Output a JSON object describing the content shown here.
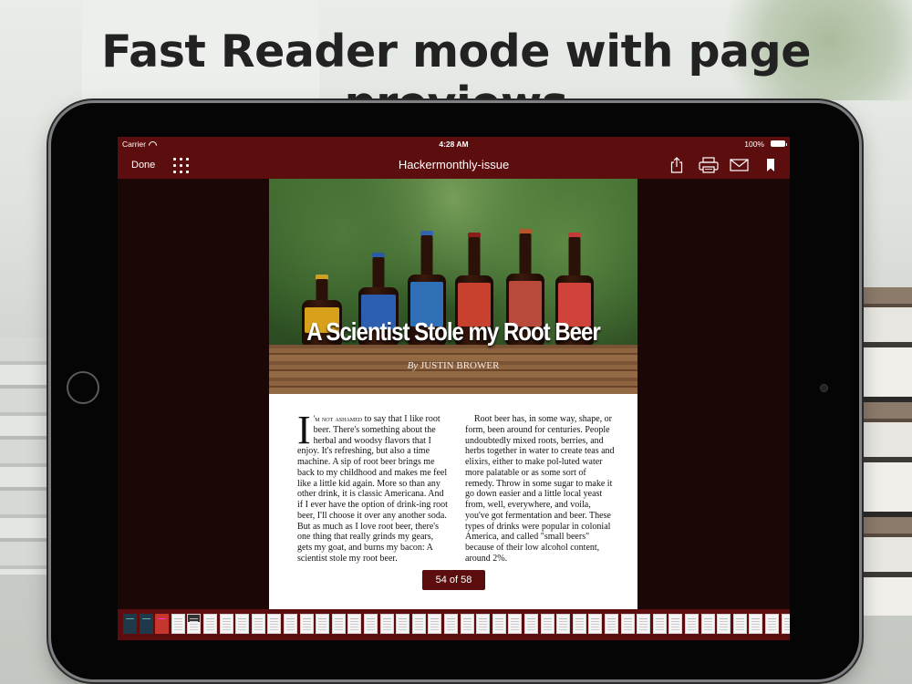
{
  "headline": "Fast Reader mode with page previews",
  "status_bar": {
    "carrier": "Carrier",
    "time": "4:28 AM",
    "battery": "100%"
  },
  "nav_bar": {
    "done_label": "Done",
    "title": "Hackermonthly-issue",
    "icons": [
      "grid-icon",
      "share-icon",
      "print-icon",
      "mail-icon",
      "bookmark-icon"
    ]
  },
  "article": {
    "title": "A Scientist Stole my Root Beer",
    "byline_prefix": "By",
    "author": "JUSTIN BROWER",
    "dropcap": "I",
    "lead_smallcaps": "'m not ashamed",
    "col1": " to say that I like root beer. There's something about the herbal and woodsy flavors that I enjoy. It's refreshing, but also a time machine. A sip of root beer brings me back to my childhood and makes me feel like a little kid again. More so than any other drink, it is classic Americana. And if I ever have the option of drink-ing root beer, I'll choose it over any another soda. But as much as I love root beer, there's one thing that really grinds my gears, gets my goat, and burns my bacon: A scientist stole my root beer.",
    "col2": "Root beer has, in some way, shape, or form, been around for centuries. People undoubtedly mixed roots, berries, and herbs together in water to create teas and elixirs, either to make pol-luted water more palatable or as some sort of remedy. Throw in some sugar to make it go down easier and a little local yeast from, well, everywhere, and voila, you've got fermentation and beer. These types of drinks were popular in colonial America, and called \"small beers\" because of their low alcohol content, around 2%."
  },
  "page_indicator": "54 of 58",
  "thumbnails": {
    "current_page": 54,
    "total_pages": 58
  },
  "colors": {
    "accent": "#5c0d0d",
    "screen_bg": "#1c0707"
  }
}
